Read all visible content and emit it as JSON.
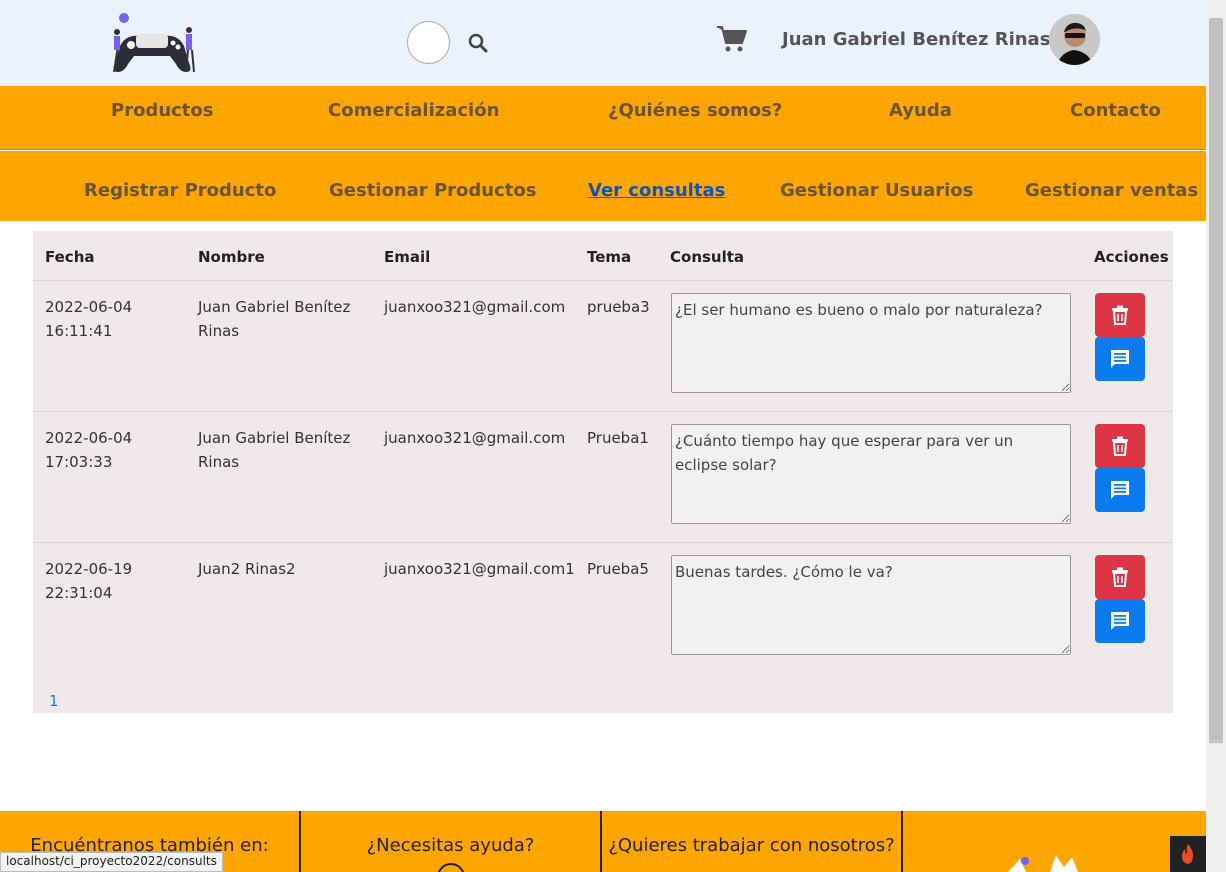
{
  "header": {
    "user_name": "Juan Gabriel Benítez Rinas",
    "logo_icon": "gamepad-logo-icon",
    "search_icon": "search-icon",
    "cart_icon": "cart-icon"
  },
  "nav_main": {
    "items": [
      "Productos",
      "Comercialización",
      "¿Quiénes somos?",
      "Ayuda",
      "Contacto"
    ]
  },
  "nav_admin": {
    "items": [
      "Registrar Producto",
      "Gestionar Productos",
      "Ver consultas",
      "Gestionar Usuarios",
      "Gestionar ventas"
    ],
    "active": "Ver consultas"
  },
  "table": {
    "headers": [
      "Fecha",
      "Nombre",
      "Email",
      "Tema",
      "Consulta",
      "Acciones"
    ],
    "rows": [
      {
        "fecha_date": "2022-06-04",
        "fecha_time": "16:11:41",
        "nombre_1": "Juan Gabriel Benítez",
        "nombre_2": "Rinas",
        "email": "juanxoo321@gmail.com",
        "tema": "prueba3",
        "consulta": "¿El ser humano es bueno o malo por naturaleza?"
      },
      {
        "fecha_date": "2022-06-04",
        "fecha_time": "17:03:33",
        "nombre_1": "Juan Gabriel Benítez",
        "nombre_2": "Rinas",
        "email": "juanxoo321@gmail.com",
        "tema": "Prueba1",
        "consulta": "¿Cuánto tiempo hay que esperar para ver un eclipse solar?"
      },
      {
        "fecha_date": "2022-06-19",
        "fecha_time": "22:31:04",
        "nombre_1": "Juan2 Rinas2",
        "nombre_2": "",
        "email": "juanxoo321@gmail.com1",
        "tema": "Prueba5",
        "consulta": "Buenas tardes. ¿Cómo le va?"
      }
    ],
    "pagination": "1"
  },
  "footer": {
    "col1": "Encuéntranos también en:",
    "col2": "¿Necesitas ayuda?",
    "col3": "¿Quieres trabajar con nosotros?"
  },
  "status_url": "localhost/ci_proyecto2022/consults",
  "colors": {
    "header_bg": "#eaf3fd",
    "nav_bg": "#ffa500",
    "delete": "#dc3545",
    "reply": "#0d7bf0"
  }
}
